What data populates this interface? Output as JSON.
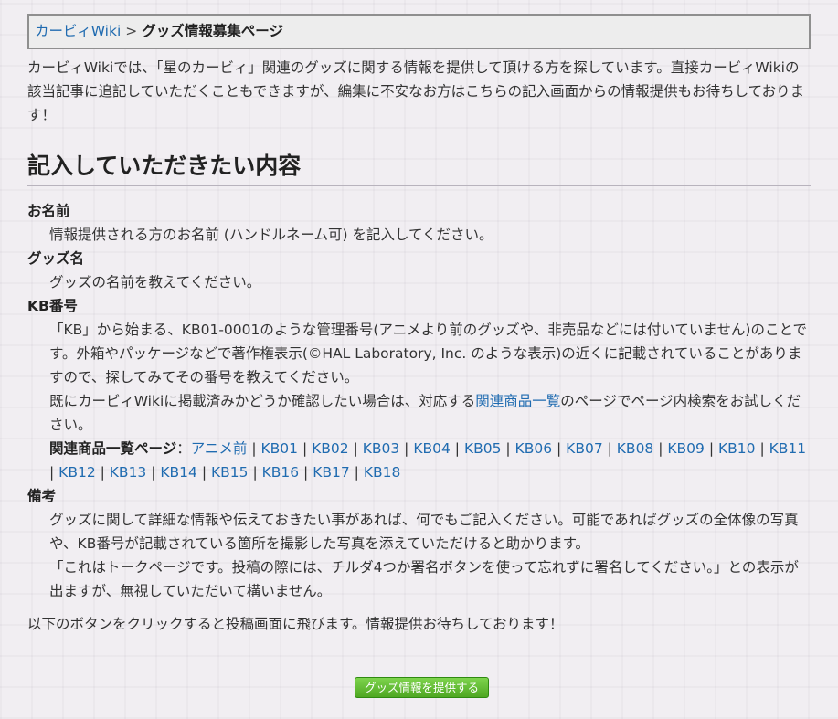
{
  "breadcrumb": {
    "parent": "カービィWiki",
    "separator": ">",
    "current": "グッズ情報募集ページ"
  },
  "intro": "カービィWikiでは、「星のカービィ」関連のグッズに関する情報を提供して頂ける方を探しています。直接カービィWikiの該当記事に追記していただくこともできますが、編集に不安なお方はこちらの記入画面からの情報提供もお待ちしております！",
  "section_title": "記入していただきたい内容",
  "fields": {
    "name": {
      "label": "お名前",
      "desc": "情報提供される方のお名前 (ハンドルネーム可) を記入してください。"
    },
    "goods": {
      "label": "グッズ名",
      "desc": "グッズの名前を教えてください。"
    },
    "kb": {
      "label": "KB番号",
      "desc1": "「KB」から始まる、KB01-0001のような管理番号(アニメより前のグッズや、非売品などには付いていません)のことです。外箱やパッケージなどで著作権表示(©HAL Laboratory, Inc. のような表示)の近くに記載されていることがありますので、探してみてその番号を教えてください。",
      "desc2_pre": "既にカービィWikiに掲載済みかどうか確認したい場合は、対応する",
      "desc2_link": "関連商品一覧",
      "desc2_post": "のページでページ内検索をお試しください。",
      "related_label": "関連商品一覧ページ",
      "related_colon": "：",
      "related_links": [
        "アニメ前",
        "KB01",
        "KB02",
        "KB03",
        "KB04",
        "KB05",
        "KB06",
        "KB07",
        "KB08",
        "KB09",
        "KB10",
        "KB11",
        "KB12",
        "KB13",
        "KB14",
        "KB15",
        "KB16",
        "KB17",
        "KB18"
      ],
      "related_separator": "|"
    },
    "notes": {
      "label": "備考",
      "desc1": "グッズに関して詳細な情報や伝えておきたい事があれば、何でもご記入ください。可能であればグッズの全体像の写真や、KB番号が記載されている箇所を撮影した写真を添えていただけると助かります。",
      "desc2": "「これはトークページです。投稿の際には、チルダ4つか署名ボタンを使って忘れずに署名してください。」との表示が出ますが、無視していただいて構いません。"
    }
  },
  "footer_note": "以下のボタンをクリックすると投稿画面に飛びます。情報提供お待ちしております！",
  "submit_button": "グッズ情報を提供する",
  "colors": {
    "link": "#1f6bb0",
    "button_green": "#5cb82e",
    "background": "#f1eef2"
  }
}
